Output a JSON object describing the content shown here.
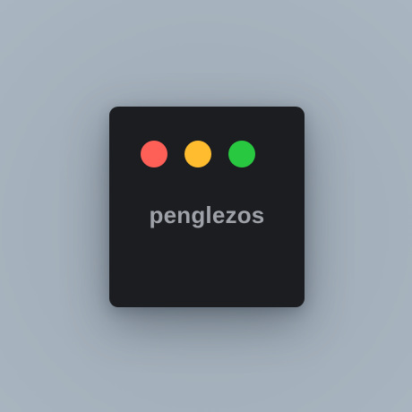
{
  "window": {
    "title": "penglezos",
    "controls": [
      {
        "name": "close",
        "color": "#fe5f57"
      },
      {
        "name": "minimize",
        "color": "#febc2e"
      },
      {
        "name": "maximize",
        "color": "#28c840"
      }
    ]
  },
  "colors": {
    "window_background": "#1c1d20",
    "title_text": "#9ea2a8",
    "page_background": "#a3afba"
  }
}
